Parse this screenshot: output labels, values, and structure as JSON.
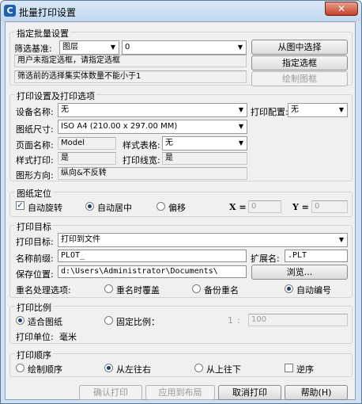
{
  "window": {
    "icon_glyph": "C",
    "title": "批量打印设置",
    "close_glyph": "✕"
  },
  "batch": {
    "group_title": "指定批量设置",
    "filter_label": "筛选基准:",
    "filter_type": "图层",
    "filter_value": "0",
    "pick_button": "从图中选择",
    "status_text": "用户未指定选框，请指定选框",
    "select_frame_button": "指定选框",
    "hint_text": "筛选前的选择集实体数量不能小于1",
    "draw_frame_button": "绘制图框"
  },
  "print_settings": {
    "group_title": "打印设置及打印选项",
    "device_label": "设备名称:",
    "device_value": "无",
    "config_label": "打印配置:",
    "config_value": "无",
    "paper_label": "图纸尺寸:",
    "paper_value": "ISO A4 (210.00 x 297.00 MM)",
    "page_label": "页面名称:",
    "page_value": "Model",
    "style_table_label": "样式表格:",
    "style_table_value": "无",
    "print_style_label": "样式打印:",
    "print_style_value": "是",
    "linewidth_label": "打印线宽:",
    "linewidth_value": "是",
    "orientation_label": "图形方向:",
    "orientation_value": "纵向&不反转"
  },
  "position": {
    "group_title": "图纸定位",
    "auto_rotate": "自动旋转",
    "auto_center": "自动居中",
    "offset": "偏移",
    "x_label": "X =",
    "x_value": "0",
    "y_label": "Y =",
    "y_value": "0"
  },
  "target": {
    "group_title": "打印目标",
    "target_label": "打印目标:",
    "target_value": "打印到文件",
    "prefix_label": "名称前缀:",
    "prefix_value": "PLOT_",
    "ext_label": "扩展名:",
    "ext_value": ".PLT",
    "save_label": "保存位置:",
    "save_value": "d:\\Users\\Administrator\\Documents\\",
    "browse_button": "浏览...",
    "rename_label": "重名处理选项:",
    "overwrite": "重名时覆盖",
    "backup": "备份重名",
    "auto_number": "自动编号"
  },
  "scale": {
    "group_title": "打印比例",
    "fit": "适合图纸",
    "fixed": "固定比例：",
    "ratio_left": "1",
    "ratio_colon": ":",
    "ratio_value": "100",
    "unit_label": "打印单位:",
    "unit_value": "毫米"
  },
  "order": {
    "group_title": "打印顺序",
    "draw_order": "绘制顺序",
    "left_to_right": "从左往右",
    "top_to_bottom": "从上往下",
    "reverse": "逆序"
  },
  "footer": {
    "confirm": "确认打印",
    "apply_layout": "应用到布局",
    "cancel": "取消打印",
    "help": "帮助(H)"
  }
}
